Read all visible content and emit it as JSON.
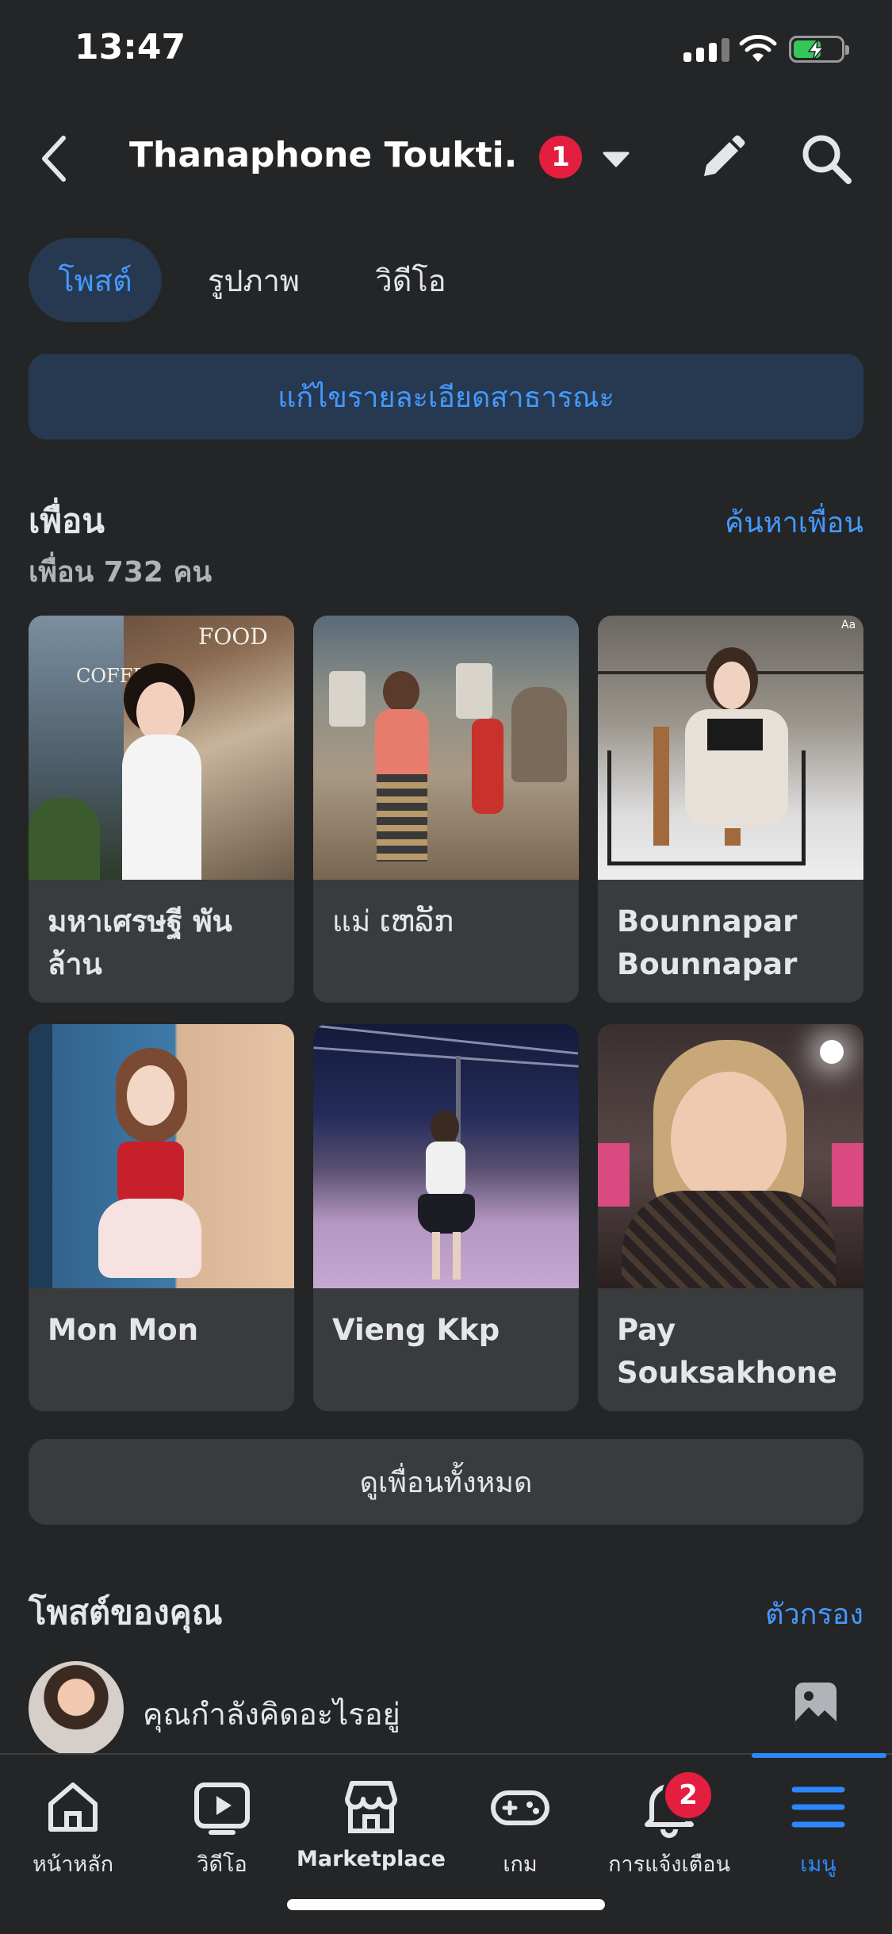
{
  "status": {
    "time": "13:47"
  },
  "header": {
    "title": "Thanaphone Toukti...",
    "badge": "1"
  },
  "tabs": [
    {
      "label": "โพสต์",
      "active": true
    },
    {
      "label": "รูปภาพ",
      "active": false
    },
    {
      "label": "วิดีโอ",
      "active": false
    }
  ],
  "edit_details_label": "แก้ไขรายละเอียดสาธารณะ",
  "friends": {
    "title": "เพื่อน",
    "count_text": "เพื่อน 732 คน",
    "find_label": "ค้นหาเพื่อน",
    "see_all_label": "ดูเพื่อนทั้งหมด",
    "list": [
      {
        "name": "มหาเศรษฐี พันล้าน"
      },
      {
        "name": "แม่ ເຫລັກ"
      },
      {
        "name": "Bounnapar Bounnapar"
      },
      {
        "name": "Mon Mon"
      },
      {
        "name": "Vieng Kkp"
      },
      {
        "name": "Pay Souksakhone"
      }
    ],
    "photo_overlay_text": {
      "coffee": "COFFEE",
      "food": "FOOD",
      "story_tool": "Aa"
    }
  },
  "posts": {
    "title": "โพสต์ของคุณ",
    "filter_label": "ตัวกรอง",
    "composer_placeholder": "คุณกำลังคิดอะไรอยู่"
  },
  "bottom_nav": {
    "items": [
      {
        "label": "หน้าหลัก",
        "icon": "home-icon"
      },
      {
        "label": "วิดีโอ",
        "icon": "video-icon"
      },
      {
        "label": "Marketplace",
        "icon": "marketplace-icon"
      },
      {
        "label": "เกม",
        "icon": "gaming-icon"
      },
      {
        "label": "การแจ้งเตือน",
        "icon": "bell-icon"
      },
      {
        "label": "เมนู",
        "icon": "menu-icon",
        "active": true
      }
    ],
    "notification_badge": "2"
  },
  "colors": {
    "background": "#242526",
    "accent": "#2d88ff",
    "badge": "#e41e3f",
    "card": "#3a3b3c",
    "tab_active_bg": "#263951"
  }
}
